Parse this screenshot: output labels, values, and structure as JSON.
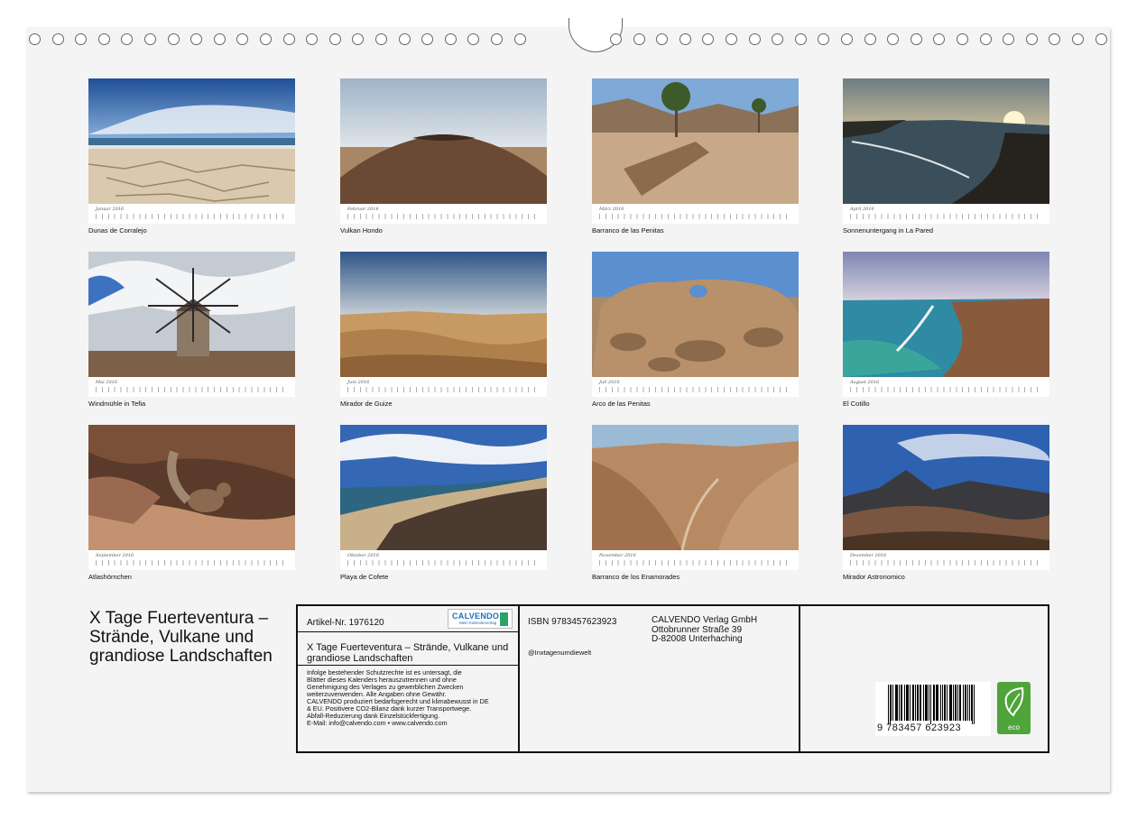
{
  "calendar": {
    "title": "X Tage Fuerteventura – Strände, Vulkane und grandiose Landschaften",
    "months": [
      {
        "month": "Januar 2016",
        "caption": "Dunas de Corralejo"
      },
      {
        "month": "Februar 2016",
        "caption": "Vulkan Hondo"
      },
      {
        "month": "März 2016",
        "caption": "Barranco de las Penitas"
      },
      {
        "month": "April 2016",
        "caption": "Sonnenuntergang in La Pared"
      },
      {
        "month": "Mai 2016",
        "caption": "Windmühle in Tefia"
      },
      {
        "month": "Juni 2016",
        "caption": "Mirador de Guize"
      },
      {
        "month": "Juli 2016",
        "caption": "Arco de las Penitas"
      },
      {
        "month": "August 2016",
        "caption": "El Cotillo"
      },
      {
        "month": "September 2016",
        "caption": "Atlashörnchen"
      },
      {
        "month": "Oktober 2016",
        "caption": "Playa de Cofete"
      },
      {
        "month": "November 2016",
        "caption": "Barranco de los Enamorades"
      },
      {
        "month": "Dezember 2016",
        "caption": "Mirador Astronomico"
      }
    ]
  },
  "info": {
    "article": "Artikel-Nr. 1976120",
    "logo_name": "CALVENDO",
    "logo_tagline": "Mein Kalenderverlag",
    "subtitle": "X Tage Fuerteventura – Strände, Vulkane und grandiose Landschaften",
    "legal_lines": [
      "Infolge bestehender Schutzrechte ist es untersagt, die",
      "Blätter dieses Kalenders herauszutrennen und ohne",
      "Genehmigung des Verlages zu gewerblichen Zwecken",
      "weiterzuverwenden. Alle Angaben ohne Gewähr.",
      "CALVENDO produziert bedarfsgerecht und klimabewusst in DE",
      "& EU. Positivere CO2-Bilanz dank kurzer Transportwege.",
      "Abfall-Reduzierung dank Einzelstückfertigung.",
      "E-Mail: info@calvendo.com • www.calvendo.com"
    ],
    "isbn": "ISBN 9783457623923",
    "handle": "@Inxtagenumdiewelt",
    "publisher_lines": [
      "CALVENDO Verlag GmbH",
      "Ottobrunner Straße 39",
      "D-82008 Unterhaching"
    ],
    "barcode_number": "9 783457 623923",
    "eco_label": "eco"
  }
}
